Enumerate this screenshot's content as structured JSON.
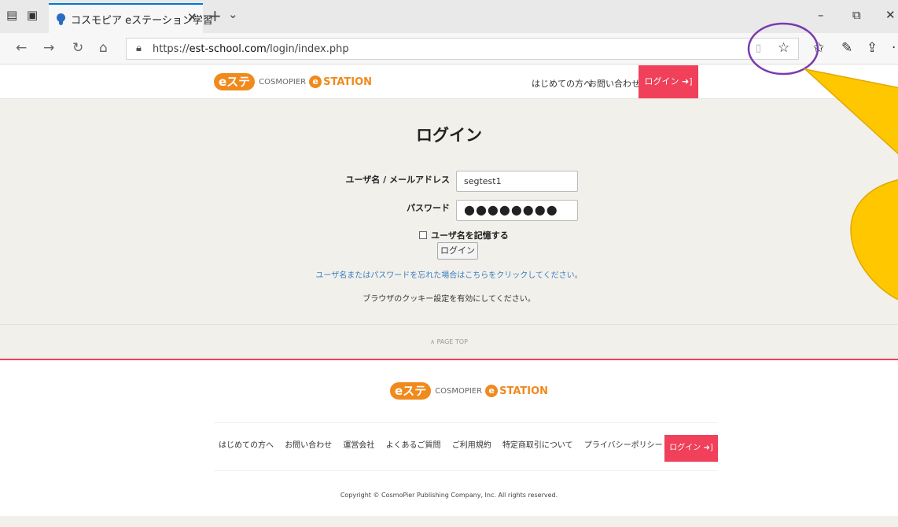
{
  "browser": {
    "tab_title": "コスモピア eステーション学習",
    "tab_close": "✕",
    "new_tab": "+",
    "tab_menu": "⌄",
    "url_prefix": "https://",
    "url_host": "est-school.com",
    "url_path": "/login/index.php",
    "window_minimize": "–",
    "window_restore": "⧉",
    "window_close": "✕"
  },
  "header": {
    "logo_este": "eステ",
    "logo_cosmopier": "COSMOPIER",
    "logo_e": "e",
    "logo_station": "STATION",
    "nav_first_time": "はじめての方へ",
    "nav_contact": "お問い合わせ",
    "login_button": "ログイン ➜]"
  },
  "login": {
    "title": "ログイン",
    "username_label": "ユーザ名 / メールアドレス",
    "username_value": "segtest1",
    "password_label": "パスワード",
    "password_value": "●●●●●●●●",
    "remember_label": "ユーザ名を記憶する",
    "submit_label": "ログイン",
    "forgot_link": "ユーザ名またはパスワードを忘れた場合はこちらをクリックしてください。",
    "cookie_note": "ブラウザのクッキー設定を有効にしてください。"
  },
  "page_top": "∧ PAGE TOP",
  "footer": {
    "links": [
      "はじめての方へ",
      "お問い合わせ",
      "運営会社",
      "よくあるご質問",
      "ご利用規約",
      "特定商取引について",
      "プライバシーポリシー"
    ],
    "login_button": "ログイン ➜]",
    "copyright": "Copyright © CosmoPier Publishing Company, Inc. All rights reserved."
  },
  "colors": {
    "accent_red": "#f0405a",
    "logo_orange": "#f08a1d",
    "page_beige": "#f2f0eb",
    "link_blue": "#3a7dbf",
    "annotation_circle": "#7a3bb0",
    "annotation_callout": "#ffc700"
  }
}
